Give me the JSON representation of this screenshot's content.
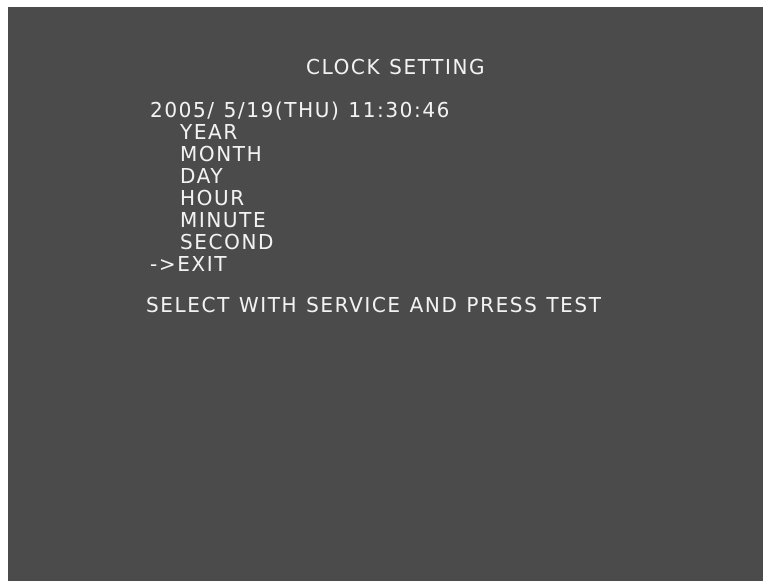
{
  "screen": {
    "title": "CLOCK SETTING",
    "current_datetime": "2005/ 5/19(THU) 11:30:46",
    "menu": [
      {
        "label": "YEAR"
      },
      {
        "label": "MONTH"
      },
      {
        "label": "DAY"
      },
      {
        "label": "HOUR"
      },
      {
        "label": "MINUTE"
      },
      {
        "label": "SECOND"
      },
      {
        "label": "EXIT"
      }
    ],
    "cursor": "->",
    "instruction": "SELECT WITH SERVICE AND PRESS TEST"
  },
  "colors": {
    "background": "#4b4b4b",
    "text": "#f2f2f2"
  }
}
